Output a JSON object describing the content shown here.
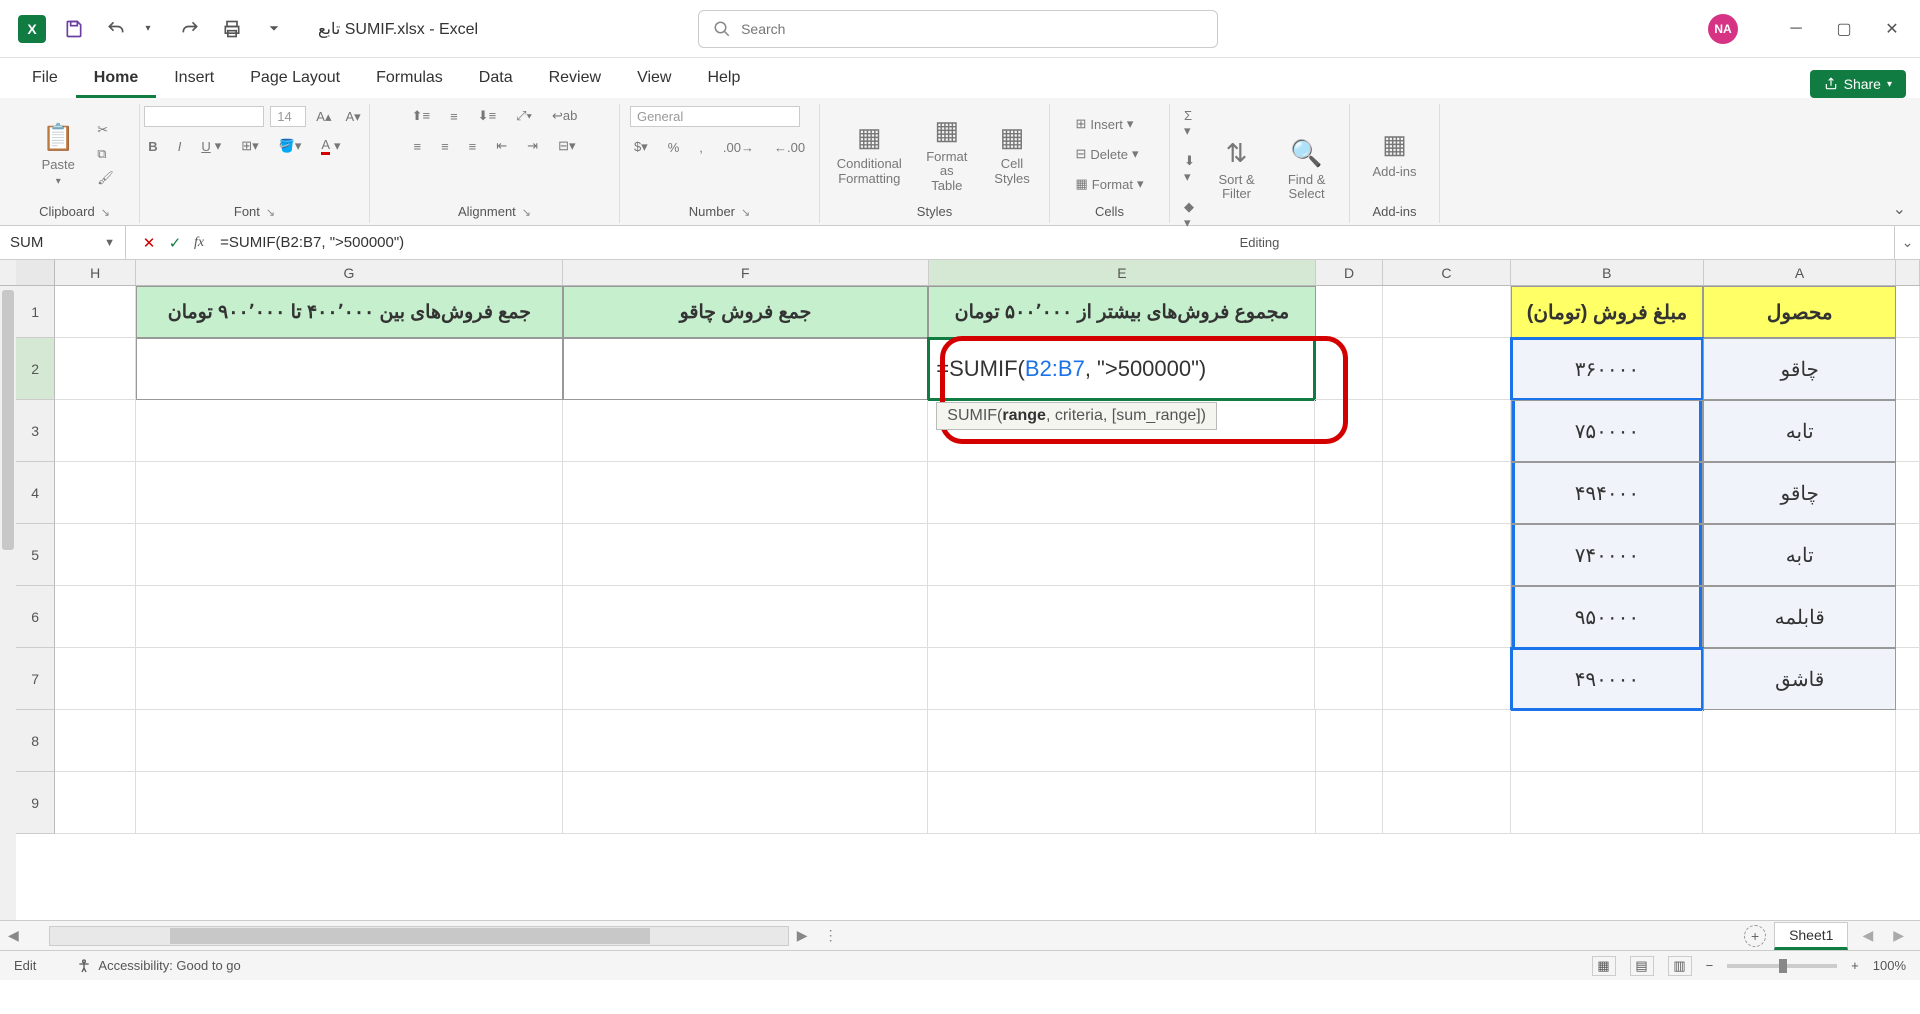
{
  "titlebar": {
    "app_letter": "X",
    "filename": "تابع SUMIF.xlsx  -  Excel",
    "search_placeholder": "Search",
    "avatar": "NA"
  },
  "tabs": {
    "file": "File",
    "home": "Home",
    "insert": "Insert",
    "page_layout": "Page Layout",
    "formulas": "Formulas",
    "data": "Data",
    "review": "Review",
    "view": "View",
    "help": "Help",
    "share": "Share"
  },
  "ribbon": {
    "clipboard": {
      "paste": "Paste",
      "label": "Clipboard"
    },
    "font": {
      "size": "14",
      "label": "Font"
    },
    "alignment": {
      "label": "Alignment"
    },
    "number": {
      "format": "General",
      "label": "Number"
    },
    "styles": {
      "cond": "Conditional Formatting",
      "fat": "Format as Table",
      "cell": "Cell Styles",
      "label": "Styles"
    },
    "cells": {
      "insert": "Insert",
      "delete": "Delete",
      "format": "Format",
      "label": "Cells"
    },
    "editing": {
      "sort": "Sort & Filter",
      "find": "Find & Select",
      "label": "Editing"
    },
    "addins": {
      "addins": "Add-ins",
      "label": "Add-ins"
    }
  },
  "formula_bar": {
    "name": "SUM",
    "formula": "=SUMIF(B2:B7, \">500000\")"
  },
  "columns": {
    "H": "H",
    "G": "G",
    "F": "F",
    "E": "E",
    "D": "D",
    "C": "C",
    "B": "B",
    "A": "A"
  },
  "rows": [
    "1",
    "2",
    "3",
    "4",
    "5",
    "6",
    "7",
    "8",
    "9"
  ],
  "headers": {
    "A": "محصول",
    "B": "مبلغ فروش (تومان)",
    "E": "مجموع فروش‌های بیشتر از ۵۰۰٬۰۰۰ تومان",
    "F": "جمع فروش چاقو",
    "G": "جمع فروش‌های بین ۴۰۰٬۰۰۰ تا ۹۰۰٬۰۰۰ تومان"
  },
  "data": {
    "r2": {
      "A": "چاقو",
      "B": "۳۶۰۰۰۰"
    },
    "r3": {
      "A": "تابه",
      "B": "۷۵۰۰۰۰"
    },
    "r4": {
      "A": "چاقو",
      "B": "۴۹۴۰۰۰"
    },
    "r5": {
      "A": "تابه",
      "B": "۷۴۰۰۰۰"
    },
    "r6": {
      "A": "قابلمه",
      "B": "۹۵۰۰۰۰"
    },
    "r7": {
      "A": "قاشق",
      "B": "۴۹۰۰۰۰"
    }
  },
  "edit_cell": {
    "prefix": "=SUMIF(",
    "ref": "B2:B7",
    "suffix": ", \">500000\")",
    "tooltip_fn": "SUMIF(",
    "tooltip_bold": "range",
    "tooltip_rest": ", criteria, [sum_range])"
  },
  "sheet": {
    "name": "Sheet1",
    "add": "+"
  },
  "status": {
    "mode": "Edit",
    "accessibility": "Accessibility: Good to go",
    "zoom": "100%"
  },
  "chart_data": {
    "type": "table",
    "title": "SUMIF example – sales amounts",
    "columns": [
      "محصول",
      "مبلغ فروش (تومان)"
    ],
    "rows": [
      [
        "چاقو",
        360000
      ],
      [
        "تابه",
        750000
      ],
      [
        "چاقو",
        494000
      ],
      [
        "تابه",
        740000
      ],
      [
        "قابلمه",
        950000
      ],
      [
        "قاشق",
        490000
      ]
    ],
    "formula": "=SUMIF(B2:B7, \">500000\")",
    "criteria": ">500000"
  }
}
